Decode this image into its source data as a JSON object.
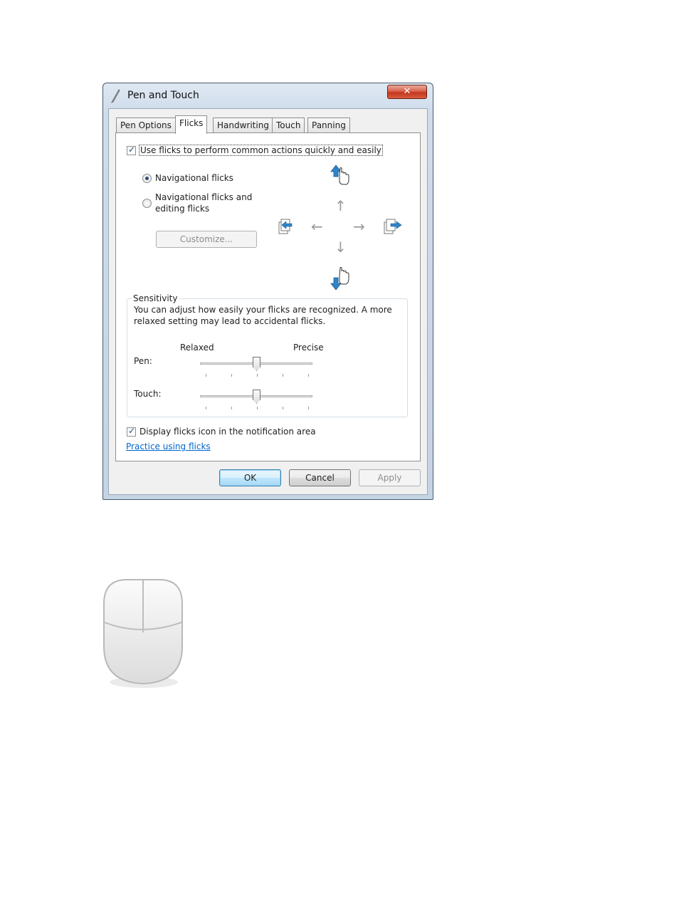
{
  "window": {
    "title": "Pen and Touch",
    "close_glyph": "✕"
  },
  "tabs": [
    {
      "label": "Pen Options"
    },
    {
      "label": "Flicks",
      "active": true
    },
    {
      "label": "Handwriting"
    },
    {
      "label": "Touch"
    },
    {
      "label": "Panning"
    }
  ],
  "flicks": {
    "use_flicks_label": "Use flicks to perform common actions quickly and easily",
    "use_flicks_checked": true,
    "options": [
      {
        "label": "Navigational flicks",
        "selected": true
      },
      {
        "label_line1": "Navigational flicks and",
        "label_line2": "editing flicks",
        "selected": false
      }
    ],
    "customize_label": "Customize...",
    "arrow_glyphs": {
      "up": "↑",
      "down": "↓",
      "left": "←",
      "right": "→"
    }
  },
  "sensitivity": {
    "group_label": "Sensitivity",
    "description_line1": "You can adjust how easily your flicks are recognized. A more",
    "description_line2": "relaxed setting may lead to accidental flicks.",
    "min_label": "Relaxed",
    "max_label": "Precise",
    "pen_label": "Pen:",
    "touch_label": "Touch:",
    "pen_level": 0.5,
    "touch_level": 0.5
  },
  "display_icon": {
    "label": "Display flicks icon in the notification area",
    "checked": true
  },
  "practice_link": "Practice using flicks",
  "buttons": {
    "ok": "OK",
    "cancel": "Cancel",
    "apply": "Apply"
  },
  "colors": {
    "accent": "#2f84c8",
    "link": "#0066cc",
    "close": "#c4361e"
  },
  "icons": [
    "pen-icon",
    "flick-up-hand-icon",
    "flick-down-hand-icon",
    "page-back-icon",
    "page-forward-icon",
    "mouse-icon"
  ]
}
